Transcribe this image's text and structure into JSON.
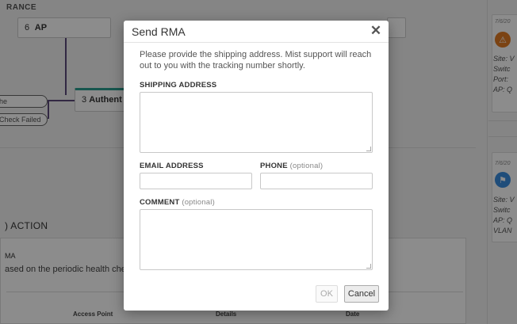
{
  "background": {
    "section_label": "RANCE",
    "ap_node": {
      "number": "6",
      "label": "AP"
    },
    "auth_node": {
      "number": "3",
      "label": "Authent"
    },
    "pills": [
      "he",
      "Check Failed"
    ],
    "action_header": ") ACTION",
    "rma_label": "MA",
    "rma_description": "ased on the periodic health chec",
    "table_headers": [
      "Access Point",
      "Details",
      "Date"
    ]
  },
  "sidebar": {
    "cards": [
      {
        "date": "7/6/20",
        "lines": [
          "Site: V",
          "Switc",
          "Port:",
          "AP: Q"
        ],
        "icon": "alert-icon",
        "icon_color": "#e07b24"
      },
      {
        "date": "7/6/20",
        "lines": [
          "Site: V",
          "Switc",
          "AP: Q",
          "VLAN"
        ],
        "icon": "flag-icon",
        "icon_color": "#3a8dde"
      }
    ]
  },
  "modal": {
    "title": "Send RMA",
    "close_icon": "close-icon",
    "intro": "Please provide the shipping address. Mist support will reach out to you with the tracking number shortly.",
    "shipping_label": "SHIPPING ADDRESS",
    "shipping_value": "",
    "email_label": "EMAIL ADDRESS",
    "email_value": "",
    "phone_label": "PHONE",
    "phone_optional": "(optional)",
    "phone_value": "",
    "comment_label": "COMMENT",
    "comment_optional": "(optional)",
    "comment_value": "",
    "ok_label": "OK",
    "cancel_label": "Cancel"
  }
}
